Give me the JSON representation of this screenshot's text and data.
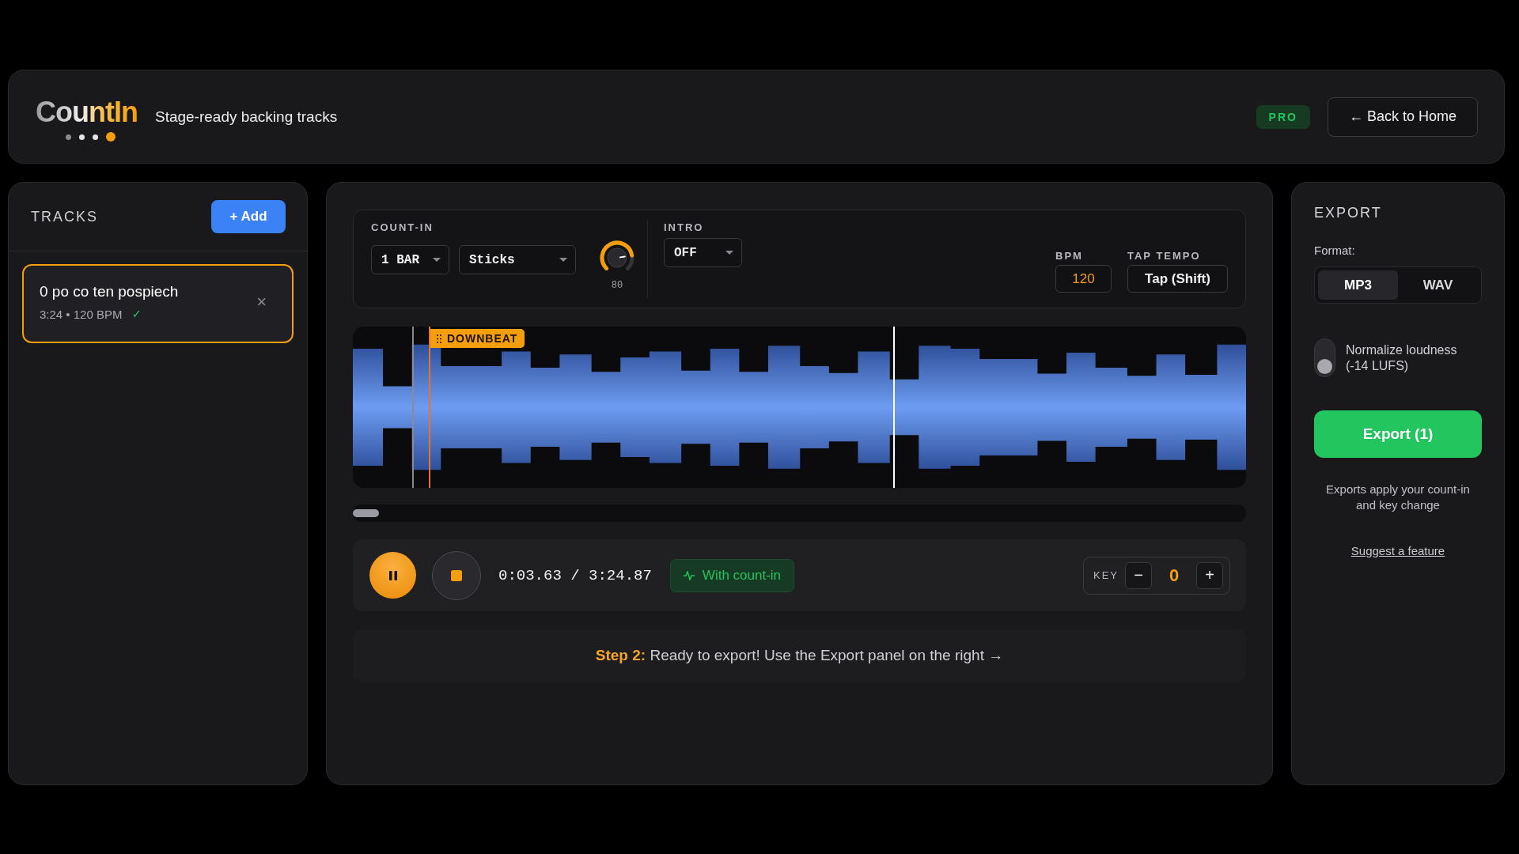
{
  "header": {
    "logo": "CountIn",
    "logo_dots": [
      {
        "color": "#8a8a8a"
      },
      {
        "color": "#e5e5e5"
      },
      {
        "color": "#e5e5e5"
      },
      {
        "color": "#f59e0b"
      }
    ],
    "tagline": "Stage-ready backing tracks",
    "badge": "PRO",
    "back_button": "← Back to Home"
  },
  "tracks": {
    "title": "TRACKS",
    "add_button": "+ Add",
    "items": [
      {
        "title": "0 po co ten pospiech",
        "meta": "3:24 • 120 BPM",
        "check": "✓",
        "close": "×",
        "selected": true
      }
    ]
  },
  "count_in": {
    "label": "COUNT-IN",
    "bars": "1 BAR",
    "sound": "Sticks",
    "volume": {
      "reading": "80"
    }
  },
  "intro": {
    "label": "INTRO",
    "value": "OFF"
  },
  "bpm": {
    "label": "BPM",
    "value": "120"
  },
  "tap_tempo": {
    "label": "TAP TEMPO",
    "button": "Tap (Shift)"
  },
  "waveform": {
    "marker": "DOWNBEAT"
  },
  "transport": {
    "playing": true,
    "time": "0:03.63 / 3:24.87",
    "status": "With count-in",
    "key": {
      "label": "KEY",
      "minus": "−",
      "value": "0",
      "plus": "+"
    }
  },
  "step": {
    "text": "**Step 2:** Ready to export! Use the Export panel on the right →"
  },
  "export": {
    "title": "EXPORT",
    "format_label": "Format:",
    "formats": [
      {
        "label": "MP3",
        "selected": true
      },
      {
        "label": "WAV",
        "selected": false
      }
    ],
    "normalize": {
      "label": "Normalize loudness (-14 LUFS)",
      "on": false
    },
    "button": "Export (1)",
    "note": "Exports apply your count-in and key change",
    "link": "Suggest a feature"
  }
}
